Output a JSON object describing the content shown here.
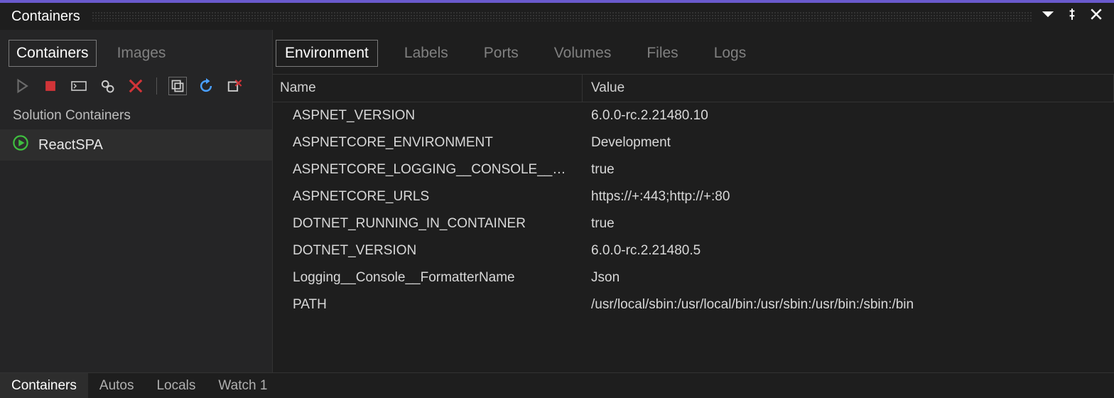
{
  "panel": {
    "title": "Containers"
  },
  "sidebar": {
    "tabs": [
      {
        "label": "Containers",
        "active": true
      },
      {
        "label": "Images",
        "active": false
      }
    ],
    "sectionHeader": "Solution Containers",
    "items": [
      {
        "label": "ReactSPA"
      }
    ]
  },
  "main": {
    "tabs": [
      {
        "label": "Environment",
        "active": true
      },
      {
        "label": "Labels",
        "active": false
      },
      {
        "label": "Ports",
        "active": false
      },
      {
        "label": "Volumes",
        "active": false
      },
      {
        "label": "Files",
        "active": false
      },
      {
        "label": "Logs",
        "active": false
      }
    ],
    "columns": {
      "name": "Name",
      "value": "Value"
    },
    "rows": [
      {
        "name": "ASPNET_VERSION",
        "value": "6.0.0-rc.2.21480.10"
      },
      {
        "name": "ASPNETCORE_ENVIRONMENT",
        "value": "Development"
      },
      {
        "name": "ASPNETCORE_LOGGING__CONSOLE__DISA...",
        "value": "true"
      },
      {
        "name": "ASPNETCORE_URLS",
        "value": "https://+:443;http://+:80"
      },
      {
        "name": "DOTNET_RUNNING_IN_CONTAINER",
        "value": "true"
      },
      {
        "name": "DOTNET_VERSION",
        "value": "6.0.0-rc.2.21480.5"
      },
      {
        "name": "Logging__Console__FormatterName",
        "value": "Json"
      },
      {
        "name": "PATH",
        "value": "/usr/local/sbin:/usr/local/bin:/usr/sbin:/usr/bin:/sbin:/bin"
      }
    ]
  },
  "bottomTabs": [
    {
      "label": "Containers",
      "active": true
    },
    {
      "label": "Autos",
      "active": false
    },
    {
      "label": "Locals",
      "active": false
    },
    {
      "label": "Watch 1",
      "active": false
    }
  ]
}
